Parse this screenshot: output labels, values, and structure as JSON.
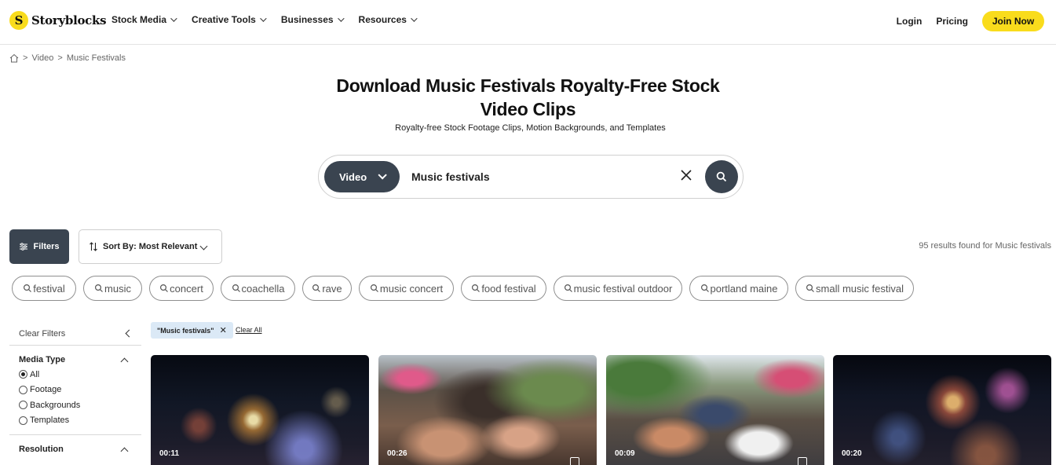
{
  "brand": {
    "name": "Storyblocks",
    "logo_letter": "S",
    "accent": "#f9dc1c",
    "dark": "#3a4450"
  },
  "nav": {
    "menu": [
      {
        "label": "Stock Media"
      },
      {
        "label": "Creative Tools"
      },
      {
        "label": "Businesses"
      },
      {
        "label": "Resources"
      }
    ],
    "login": "Login",
    "pricing": "Pricing",
    "join": "Join Now"
  },
  "breadcrumb": {
    "items": [
      "Video",
      "Music Festivals"
    ],
    "separator": ">"
  },
  "hero": {
    "title_line1": "Download Music Festivals Royalty-Free Stock",
    "title_line2": "Video Clips",
    "subtitle": "Royalty-free Stock Footage Clips, Motion Backgrounds, and Templates"
  },
  "search": {
    "type_label": "Video",
    "query": "Music festivals",
    "icons": [
      "chevron-down-icon",
      "close-icon",
      "search-icon"
    ]
  },
  "toolbar": {
    "filters_label": "Filters",
    "sort_label": "Sort By: Most Relevant",
    "results_text": "95 results found for Music festivals"
  },
  "related_tags": [
    "festival",
    "music",
    "concert",
    "coachella",
    "rave",
    "music concert",
    "food festival",
    "music festival outdoor",
    "portland maine",
    "small music festival"
  ],
  "sidebar": {
    "clear_filters": "Clear Filters",
    "media_type": {
      "title": "Media Type",
      "options": [
        "All",
        "Footage",
        "Backgrounds",
        "Templates"
      ],
      "selected": "All"
    },
    "resolution": {
      "title": "Resolution"
    }
  },
  "active_filters": {
    "chip": "\"Music festivals\"",
    "clear_all": "Clear All"
  },
  "videos": [
    {
      "duration": "00:11"
    },
    {
      "duration": "00:26"
    },
    {
      "duration": "00:09"
    },
    {
      "duration": "00:20"
    }
  ]
}
